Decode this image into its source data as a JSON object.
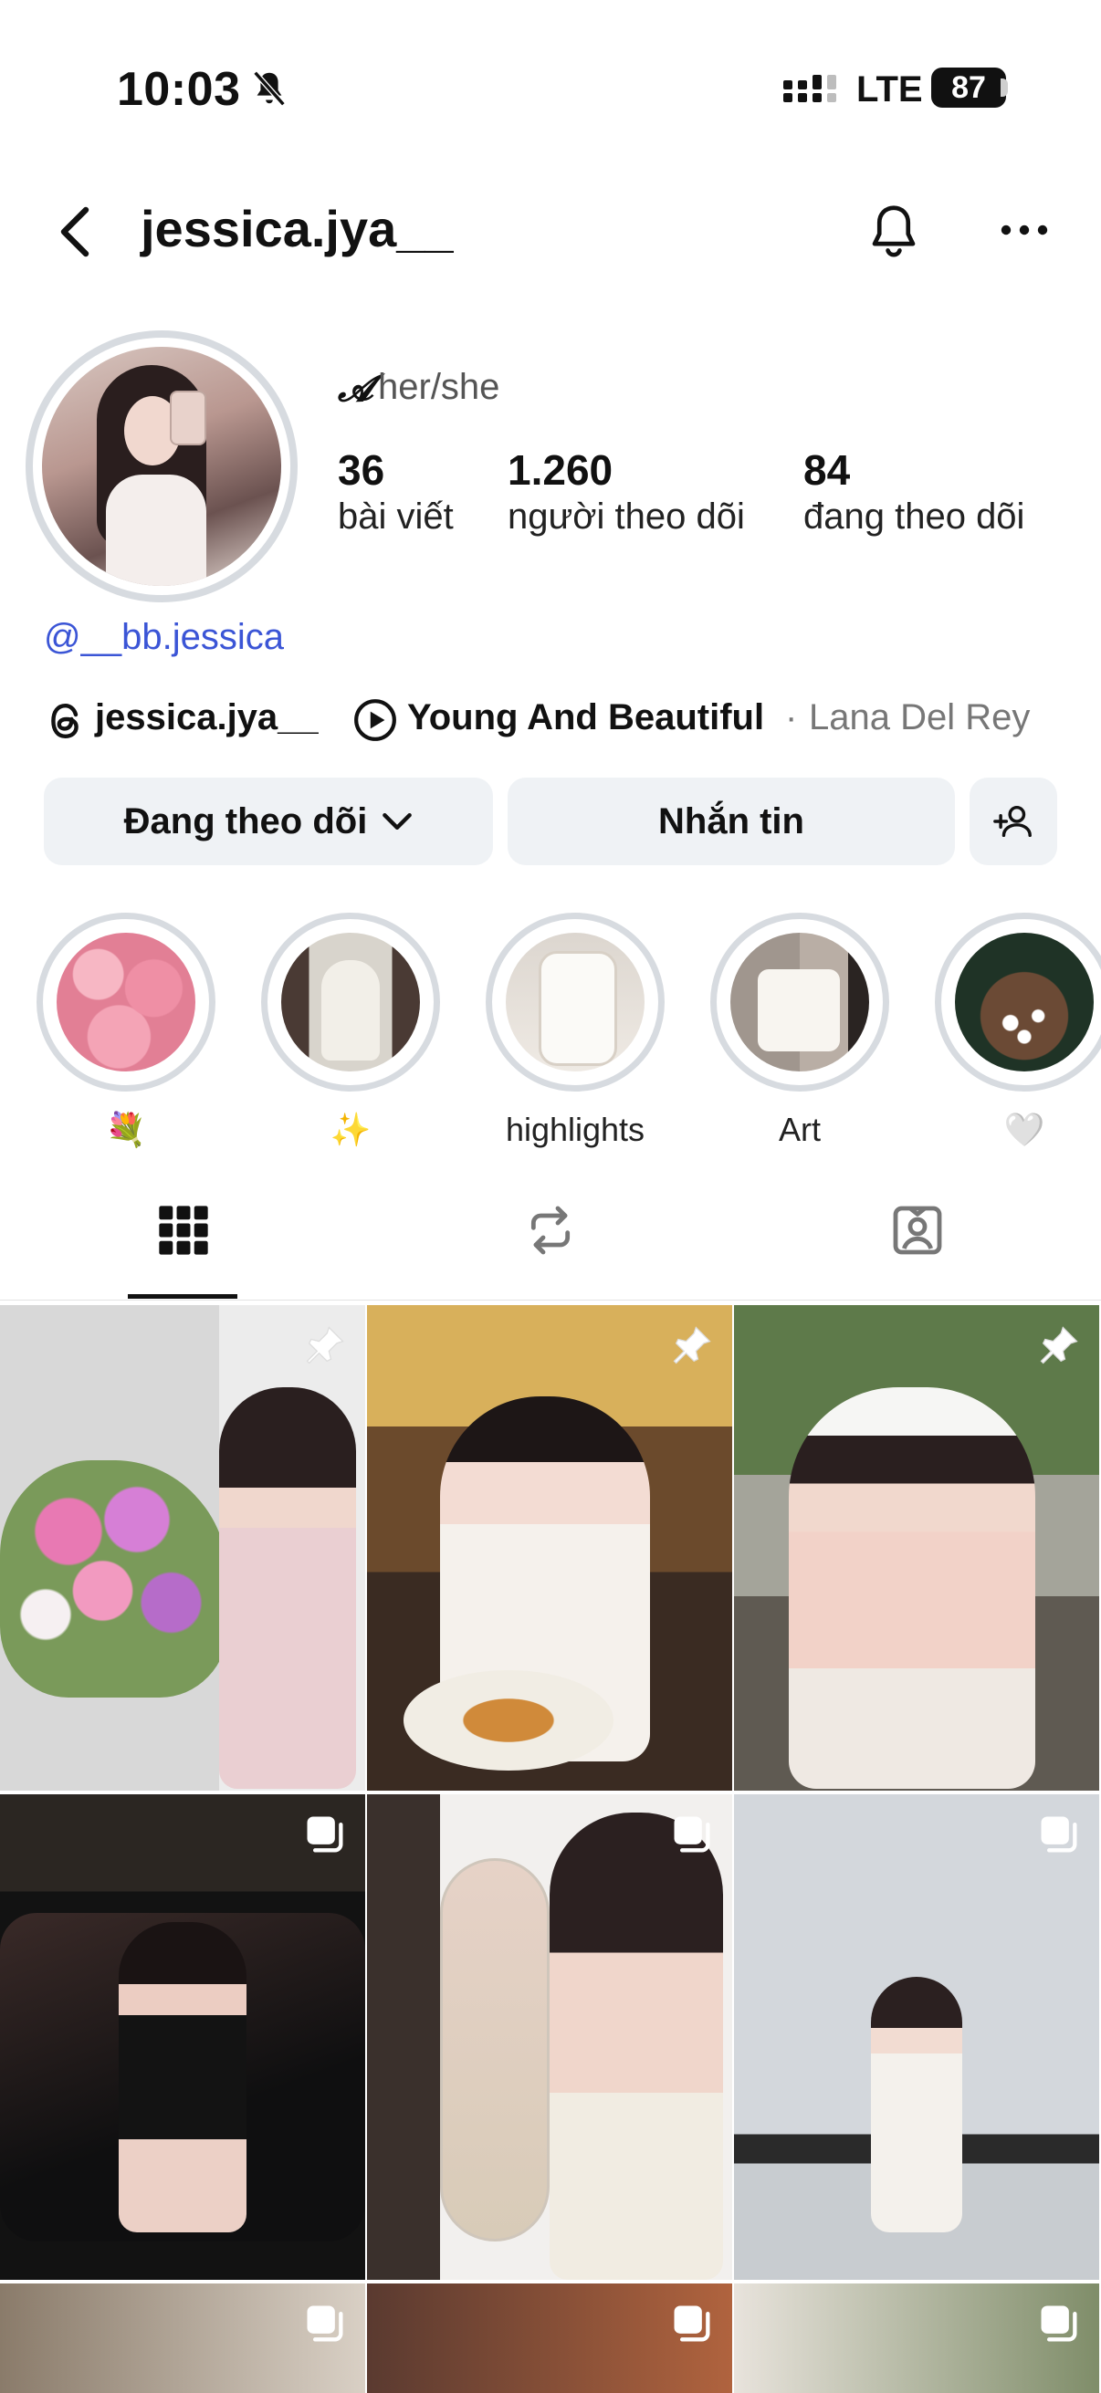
{
  "status_bar": {
    "time": "10:03",
    "network": "LTE",
    "battery": "87"
  },
  "header": {
    "username": "jessica.jya__"
  },
  "profile": {
    "pronouns": "her/she",
    "pronoun_icon": "𝓐",
    "stats": [
      {
        "value": "36",
        "label": "bài viết"
      },
      {
        "value": "1.260",
        "label": "người theo dõi"
      },
      {
        "value": "84",
        "label": "đang theo dõi"
      }
    ],
    "mention": "@__bb.jessica",
    "threads_username": "jessica.jya__",
    "music": {
      "title": "Young And Beautiful",
      "separator": "·",
      "artist": "Lana Del Rey"
    }
  },
  "buttons": {
    "following": "Đang theo dõi",
    "message": "Nhắn tin"
  },
  "highlights": [
    {
      "label": "💐"
    },
    {
      "label": "✨"
    },
    {
      "label": "highlights"
    },
    {
      "label": "Art"
    },
    {
      "label": "🤍"
    }
  ],
  "tabs": [
    "grid-icon",
    "reels-repost-icon",
    "tagged-icon"
  ],
  "colors": {
    "accent_link": "#3b55d6",
    "button_bg": "#eff2f5",
    "ring": "#d7dbe0"
  }
}
